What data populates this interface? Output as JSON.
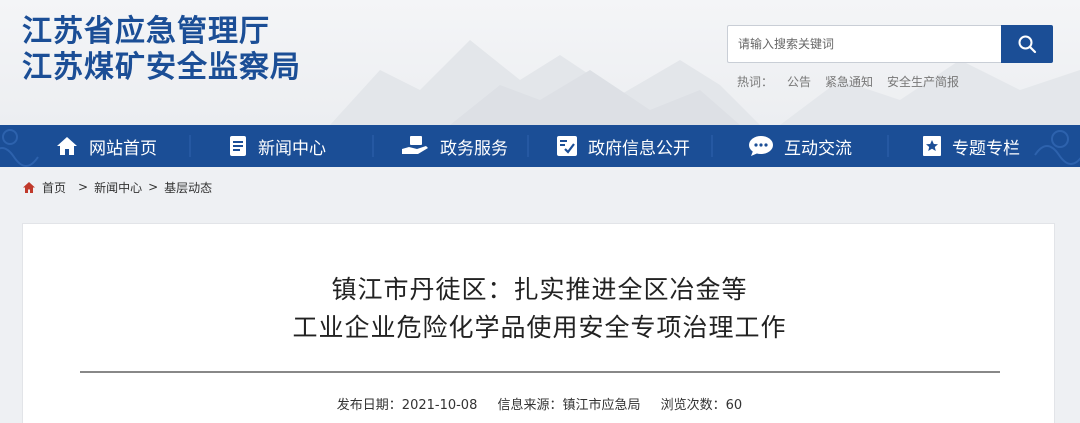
{
  "header": {
    "title_line1": "江苏省应急管理厅",
    "title_line2": "江苏煤矿安全监察局",
    "search_placeholder": "请输入搜索关键词",
    "hot_label": "热词：",
    "hot_words": [
      "公告",
      "紧急通知",
      "安全生产简报"
    ],
    "colors": {
      "brand": "#1b4e96"
    }
  },
  "nav": {
    "items": [
      {
        "label": "网站首页",
        "icon": "home-icon"
      },
      {
        "label": "新闻中心",
        "icon": "document-icon"
      },
      {
        "label": "政务服务",
        "icon": "hand-service-icon"
      },
      {
        "label": "政府信息公开",
        "icon": "info-check-icon"
      },
      {
        "label": "互动交流",
        "icon": "chat-bubble-icon"
      },
      {
        "label": "专题专栏",
        "icon": "bookmark-icon"
      }
    ]
  },
  "breadcrumb": {
    "home": "首页",
    "level1": "新闻中心",
    "level2": "基层动态",
    "separator": ">"
  },
  "article": {
    "title_line1": "镇江市丹徒区：扎实推进全区冶金等",
    "title_line2": "工业企业危险化学品使用安全专项治理工作",
    "publish_date": "发布日期：2021-10-08",
    "source": "信息来源：镇江市应急局",
    "views": "浏览次数：60"
  }
}
